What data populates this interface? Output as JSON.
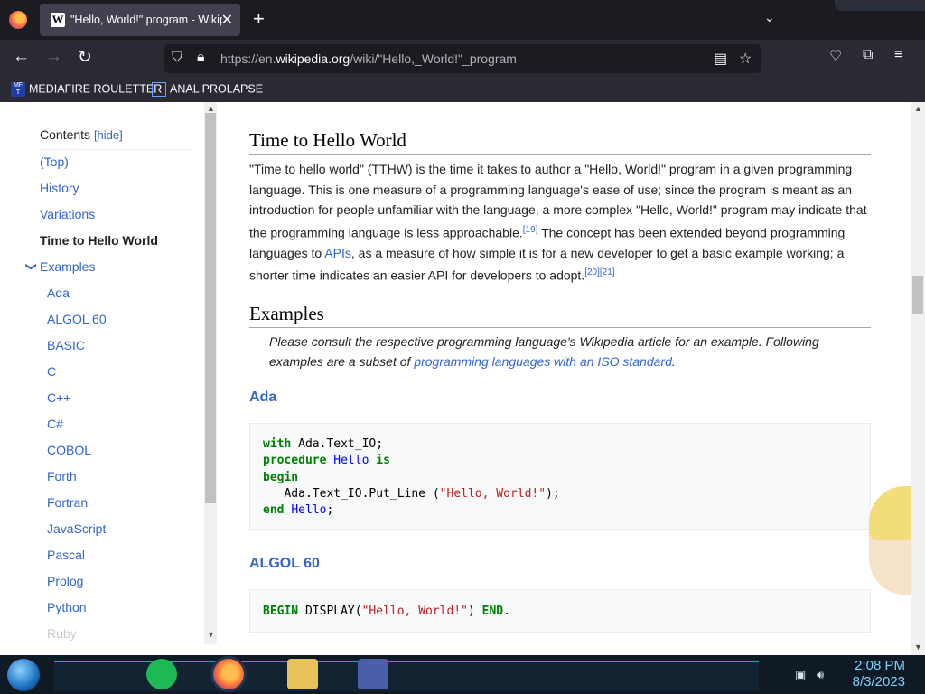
{
  "browser": {
    "tab_title": "\"Hello, World!\" program - Wikipedia",
    "tab_favicon": "W",
    "url_prefix": "https://en.",
    "url_domain": "wikipedia.org",
    "url_path": "/wiki/\"Hello,_World!\"_program",
    "bookmarks": [
      "MEDIAFIRE ROULETTER",
      "ANAL PROLAPSE"
    ]
  },
  "toc": {
    "title": "Contents",
    "hide": "[hide]",
    "items": [
      {
        "label": "(Top)"
      },
      {
        "label": "History"
      },
      {
        "label": "Variations"
      },
      {
        "label": "Time to Hello World",
        "active": true
      },
      {
        "label": "Examples",
        "expanded": true
      },
      {
        "label": "Ada",
        "sub": true
      },
      {
        "label": "ALGOL 60",
        "sub": true
      },
      {
        "label": "BASIC",
        "sub": true
      },
      {
        "label": "C",
        "sub": true
      },
      {
        "label": "C++",
        "sub": true
      },
      {
        "label": "C#",
        "sub": true
      },
      {
        "label": "COBOL",
        "sub": true
      },
      {
        "label": "Forth",
        "sub": true
      },
      {
        "label": "Fortran",
        "sub": true
      },
      {
        "label": "JavaScript",
        "sub": true
      },
      {
        "label": "Pascal",
        "sub": true
      },
      {
        "label": "Prolog",
        "sub": true
      },
      {
        "label": "Python",
        "sub": true
      },
      {
        "label": "Ruby",
        "sub": true
      }
    ]
  },
  "article": {
    "section1_title": "Time to Hello World",
    "p1_a": "\"Time to hello world\" (TTHW) is the time it takes to author a \"Hello, World!\" program in a given programming language. This is one measure of a programming language's ease of use; since the program is meant as an introduction for people unfamiliar with the language, a more complex \"Hello, World!\" program may indicate that the programming language is less approachable.",
    "ref19": "[19]",
    "p1_b": " The concept has been extended beyond programming languages to ",
    "apis": "APIs",
    "p1_c": ", as a measure of how simple it is for a new developer to get a basic example working; a shorter time indicates an easier API for developers to adopt.",
    "ref20": "[20]",
    "ref21": "[21]",
    "section2_title": "Examples",
    "hatnote_a": "Please consult the respective programming language's Wikipedia article for an example. Following examples are a subset of ",
    "hatnote_link": "programming languages with an ISO standard",
    "hatnote_b": ".",
    "ada_title": "Ada",
    "ada_code": {
      "l1_kw": "with",
      "l1_rest": " Ada.Text_IO;",
      "l2_kw": "procedure",
      "l2_nm": "Hello",
      "l2_kw2": "is",
      "l3_kw": "begin",
      "l4_a": "   Ada.Text_IO.Put_Line (",
      "l4_st": "\"Hello, World!\"",
      "l4_b": ");",
      "l5_kw": "end",
      "l5_nm": "Hello",
      "l5_b": ";"
    },
    "algol_title": "ALGOL 60",
    "algol_code": {
      "kw1": "BEGIN",
      "a": " DISPLAY(",
      "st": "\"Hello, World!\"",
      "b": ") ",
      "kw2": "END",
      "c": "."
    }
  },
  "taskbar": {
    "time": "2:08 PM",
    "date": "8/3/2023"
  },
  "colors": {
    "link": "#3366cc",
    "accent": "#1aa6c8"
  }
}
